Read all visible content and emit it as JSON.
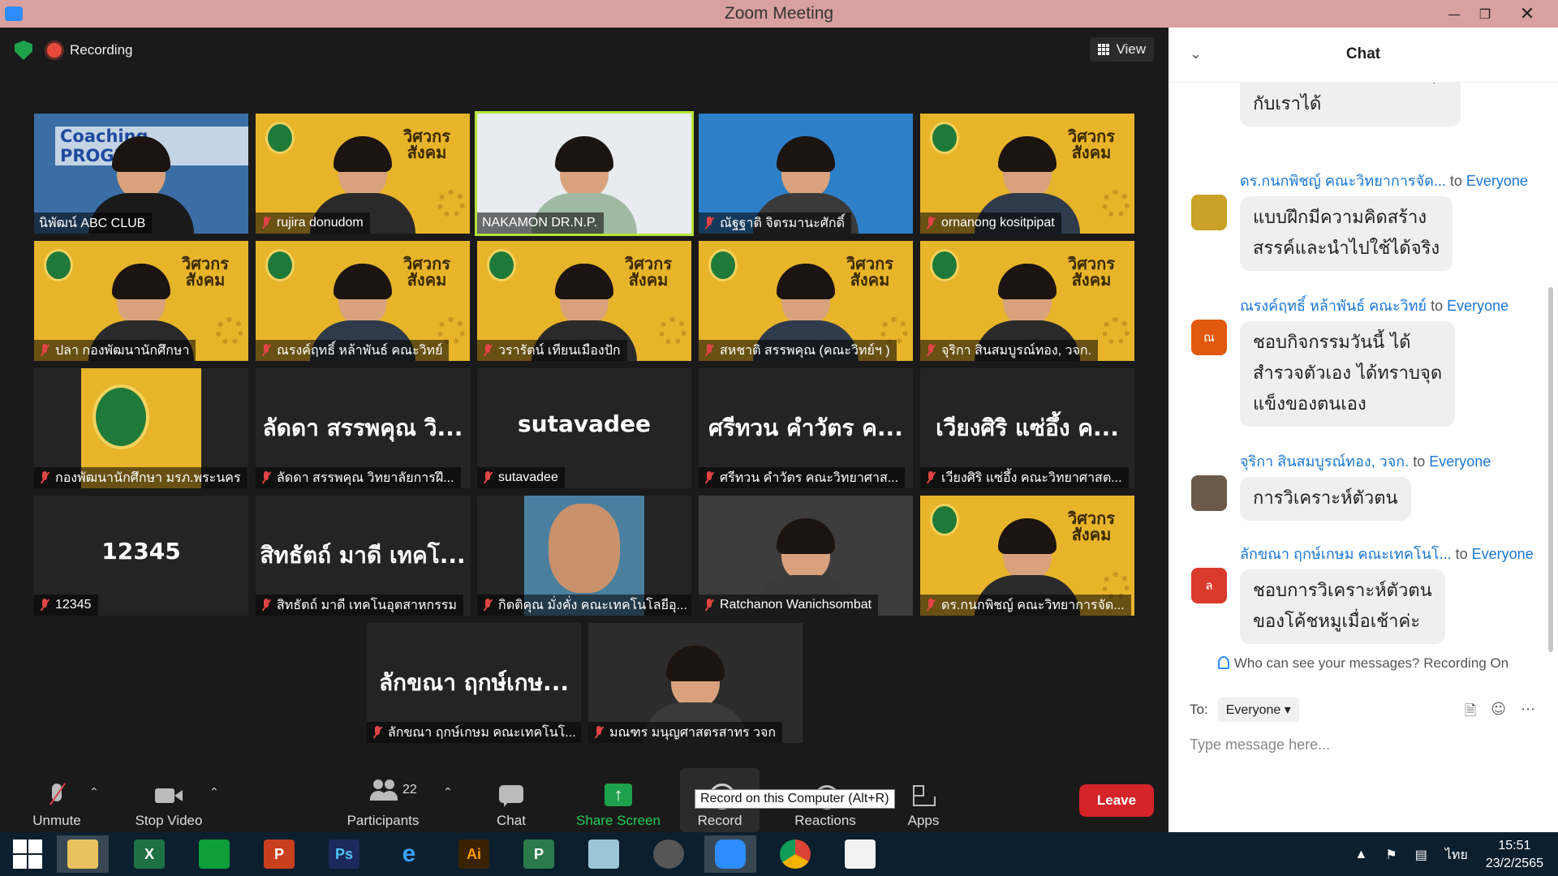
{
  "window": {
    "title": "Zoom Meeting"
  },
  "top": {
    "recording_label": "Recording",
    "view_label": "View"
  },
  "tiles": [
    {
      "name": "นิพัฒน์ ABC CLUB",
      "big": "",
      "muted": false
    },
    {
      "name": "rujira donudom",
      "big": "",
      "muted": true
    },
    {
      "name": "NAKAMON DR.N.P.",
      "big": "",
      "muted": false,
      "active": true
    },
    {
      "name": "ณัฐฐาติ จิตรมานะศักดิ์",
      "big": "",
      "muted": true
    },
    {
      "name": "ornanong kositpipat",
      "big": "",
      "muted": true
    },
    {
      "name": "ปลา กองพัฒนานักศึกษา",
      "big": "",
      "muted": true
    },
    {
      "name": "ณรงค์ฤทธิ์ หล้าพันธ์ คณะวิทย์",
      "big": "",
      "muted": true
    },
    {
      "name": "วรารัตน์ เทียนเมืองปัก",
      "big": "",
      "muted": true
    },
    {
      "name": "สหชาติ สรรพคุณ (คณะวิทย์ฯ )",
      "big": "",
      "muted": true
    },
    {
      "name": "จุริกา สินสมบูรณ์ทอง, วจก.",
      "big": "",
      "muted": true
    },
    {
      "name": "กองพัฒนานักศึกษา มรภ.พระนคร",
      "big": "",
      "muted": true
    },
    {
      "name": "ลัดดา สรรพคุณ วิทยาลัยการฝึ...",
      "big": "ลัดดา สรรพคุณ วิ...",
      "muted": true
    },
    {
      "name": "sutavadee",
      "big": "sutavadee",
      "muted": true
    },
    {
      "name": "ศรีทวน คำวัตร คณะวิทยาศาส...",
      "big": "ศรีทวน คำวัตร ค...",
      "muted": true
    },
    {
      "name": "เวียงศิริ แซ่อึ้ง คณะวิทยาศาสต...",
      "big": "เวียงศิริ แซ่อึ้ง ค...",
      "muted": true
    },
    {
      "name": "12345",
      "big": "12345",
      "muted": true
    },
    {
      "name": "สิทธัตถ์ มาดี เทคโนอุตสาหกรรม",
      "big": "สิทธัตถ์ มาดี เทคโ...",
      "muted": true
    },
    {
      "name": "กิตติคุณ มั่งคั่ง คณะเทคโนโลยีอุ...",
      "big": "",
      "muted": true
    },
    {
      "name": "Ratchanon Wanichsombat",
      "big": "",
      "muted": true
    },
    {
      "name": "ดร.กนกพิชญ์ คณะวิทยาการจัด...",
      "big": "",
      "muted": true
    },
    {
      "name": "ลักขณา ฤกษ์เกษม คณะเทคโนโ...",
      "big": "ลักขณา ฤกษ์เกษ...",
      "muted": true
    },
    {
      "name": "มณฑร มนุญศาสตรสาทร วจก",
      "big": "",
      "muted": true
    }
  ],
  "banner": {
    "line1": "วิศวกร",
    "line2": "สังคม",
    "coaching": "Coaching PROGRAM"
  },
  "toolbar": {
    "unmute": "Unmute",
    "stop_video": "Stop Video",
    "participants": "Participants",
    "participants_count": "22",
    "chat": "Chat",
    "share_screen": "Share Screen",
    "record": "Record",
    "record_tooltip": "Record on this Computer (Alt+R)",
    "reactions": "Reactions",
    "apps": "Apps",
    "leave": "Leave"
  },
  "chat": {
    "title": "Chat",
    "messages": [
      {
        "sender": "",
        "to": "",
        "text": "ก็ความมักสวะได้ความสุข\nกับเราได้",
        "avatar": "",
        "avatar_color": ""
      },
      {
        "sender": "ดร.กนกพิชญ์ คณะวิทยาการจัด...",
        "to": "Everyone",
        "text": "แบบฝึกมีความคิดสร้าง\nสรรค์และนำไปใช้ได้จริง",
        "avatar": "",
        "avatar_color": "#c9a227"
      },
      {
        "sender": "ณรงค์ฤทธิ์ หล้าพันธ์ คณะวิทย์",
        "to": "Everyone",
        "text": "ชอบกิจกรรมวันนี้ ได้\nสำรวจตัวเอง ได้ทราบจุด\nแข็งของตนเอง",
        "avatar": "ณ",
        "avatar_color": "#e0590f"
      },
      {
        "sender": "จุริกา สินสมบูรณ์ทอง, วจก.",
        "to": "Everyone",
        "text": "การวิเคราะห์ตัวตน",
        "avatar": "",
        "avatar_color": "#6b5a4a"
      },
      {
        "sender": "ลักขณา ฤกษ์เกษม คณะเทคโนโ...",
        "to": "Everyone",
        "text": "ชอบการวิเคราะห์ตัวตน\nของโค้ชหมูเมื่อเช้าค่ะ",
        "avatar": "ล",
        "avatar_color": "#d93a2b"
      }
    ],
    "to_word": "to",
    "privacy": "Who can see your messages? Recording On",
    "to_label": "To:",
    "recipient": "Everyone",
    "placeholder": "Type message here..."
  },
  "taskbar": {
    "apps": [
      "windows-start",
      "file-explorer",
      "excel",
      "store",
      "powerpoint",
      "photoshop",
      "internet-explorer",
      "illustrator",
      "project",
      "notepad",
      "hotocape",
      "zoom",
      "chrome",
      "presentation"
    ],
    "language": "ไทย",
    "time": "15:51",
    "date": "23/2/2565"
  },
  "colors": {
    "zoom_blue": "#2d8cff",
    "share_green": "#1fce5a",
    "leave_red": "#d4242a",
    "active_border": "#b5e33b"
  }
}
